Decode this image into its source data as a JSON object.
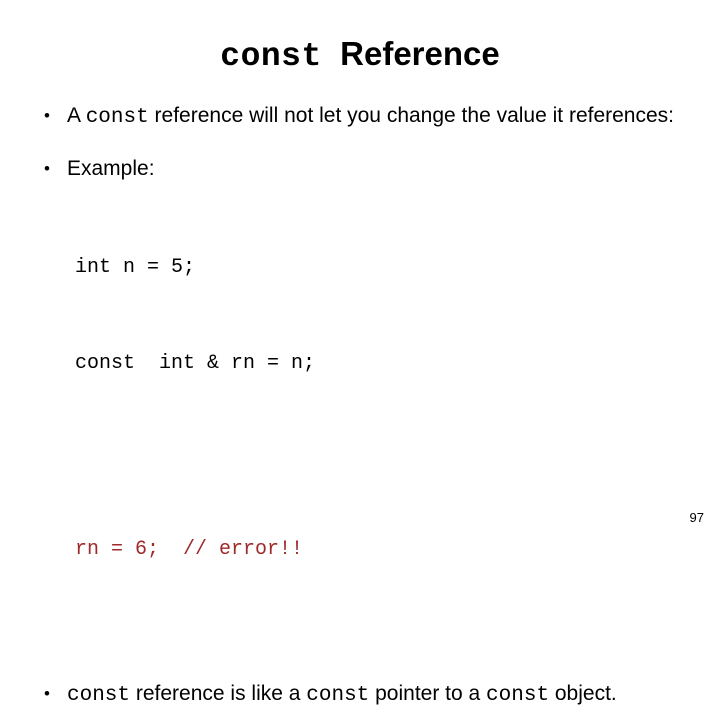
{
  "slide": {
    "title": {
      "mono_part": "const",
      "sans_part": "Reference",
      "full_text": "const Reference"
    },
    "bullets": [
      {
        "marker": "•",
        "segments": [
          {
            "text": "A ",
            "style": "sans"
          },
          {
            "text": "const",
            "style": "mono"
          },
          {
            "text": "  reference will not let you change the value it references:",
            "style": "sans"
          }
        ],
        "plain_text": "A const  reference will not let you change the value it references:"
      },
      {
        "marker": "•",
        "segments": [
          {
            "text": "Example:",
            "style": "sans"
          }
        ],
        "plain_text": "Example:"
      },
      {
        "marker": "•",
        "segments": [
          {
            "text": "const",
            "style": "mono"
          },
          {
            "text": "  reference is like a ",
            "style": "sans"
          },
          {
            "text": "const",
            "style": "mono"
          },
          {
            "text": "  pointer to a ",
            "style": "sans"
          },
          {
            "text": "const",
            "style": "mono"
          },
          {
            "text": "  object.",
            "style": "sans"
          }
        ],
        "plain_text": "const  reference is like a const  pointer to a const  object."
      }
    ],
    "code": {
      "lines": [
        {
          "text": "int n = 5;",
          "color": "normal"
        },
        {
          "text": "const  int & rn = n;",
          "color": "normal"
        }
      ],
      "error_lines": [
        {
          "text": "rn = 6;  // error!!",
          "color": "error"
        }
      ]
    },
    "page_number": "97",
    "colors": {
      "background": "#ffffff",
      "text": "#000000",
      "error_red": "#9e2a2a"
    }
  }
}
